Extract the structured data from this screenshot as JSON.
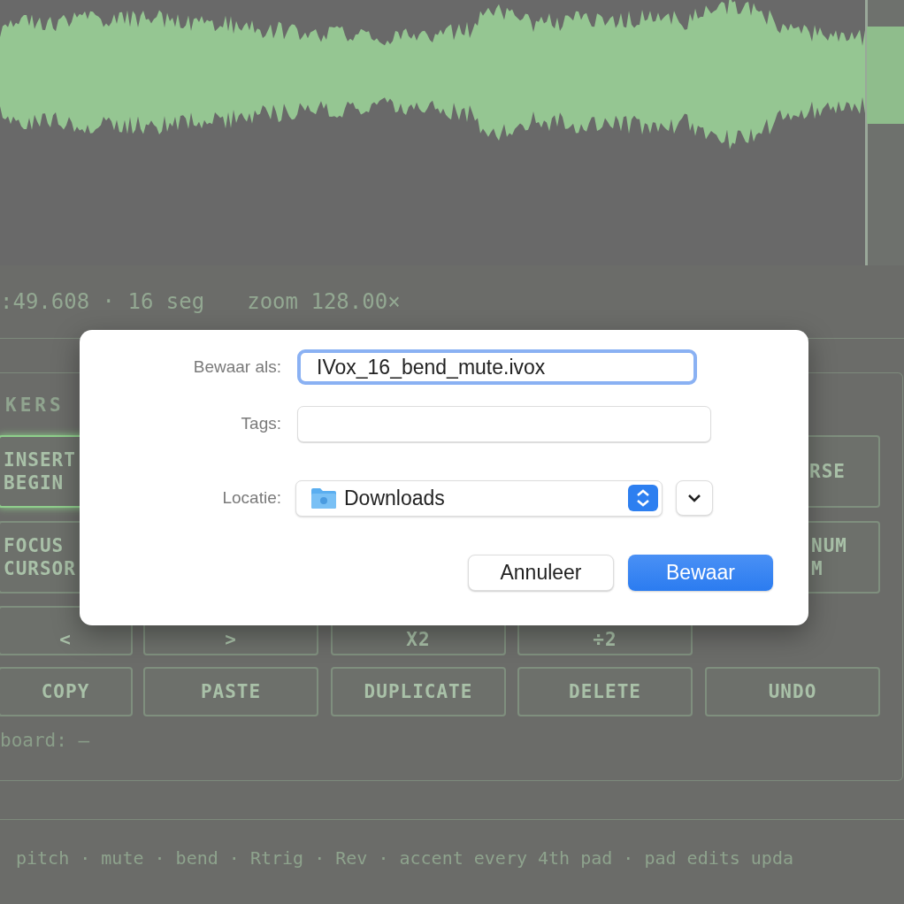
{
  "status": {
    "position": ":49.608 · 16 seg",
    "zoom": "zoom 128.00×"
  },
  "panel": {
    "heading": "KERS",
    "rows": [
      [
        {
          "lines": [
            "INSERT",
            "BEGIN"
          ],
          "selected": true
        },
        {
          "lines": [
            "RSE"
          ],
          "selected": false
        }
      ],
      [
        {
          "lines": [
            "FOCUS",
            "CURSOR"
          ],
          "selected": false
        },
        {
          "lines": [
            "NUM",
            "M"
          ],
          "selected": false
        }
      ],
      [
        {
          "lines": [
            "<"
          ],
          "selected": false
        },
        {
          "lines": [
            ">"
          ],
          "selected": false
        },
        {
          "lines": [
            "X2"
          ],
          "selected": false
        },
        {
          "lines": [
            "÷2"
          ],
          "selected": false
        }
      ],
      [
        {
          "lines": [
            "COPY"
          ],
          "selected": false
        },
        {
          "lines": [
            "PASTE"
          ],
          "selected": false
        },
        {
          "lines": [
            "DUPLICATE"
          ],
          "selected": false
        },
        {
          "lines": [
            "DELETE"
          ],
          "selected": false
        },
        {
          "lines": [
            "UNDO"
          ],
          "selected": false
        }
      ]
    ],
    "clipboard": "board: —"
  },
  "footer": "pitch · mute · bend · Rtrig · Rev · accent every 4th pad · pad edits upda",
  "dialog": {
    "name_label": "Bewaar als:",
    "name_value": "IVox_16_bend_mute.ivox",
    "tags_label": "Tags:",
    "location_label": "Locatie:",
    "location": "Downloads",
    "buttons": [
      {
        "label": "Annuleer",
        "kind": "secondary"
      },
      {
        "label": "Bewaar",
        "kind": "primary"
      }
    ]
  }
}
